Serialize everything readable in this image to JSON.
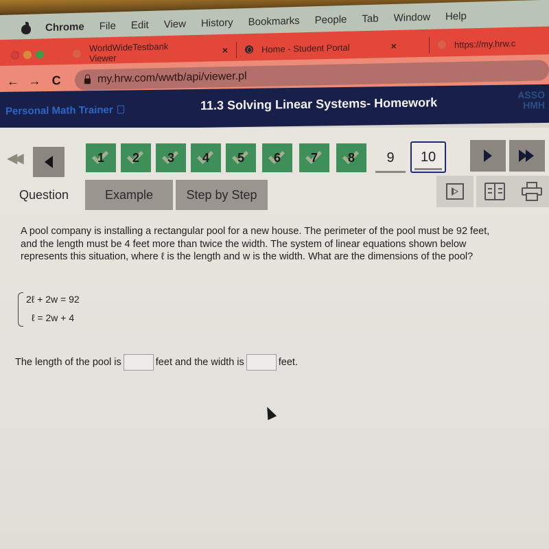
{
  "menubar": {
    "items": [
      "Chrome",
      "File",
      "Edit",
      "View",
      "History",
      "Bookmarks",
      "People",
      "Tab",
      "Window",
      "Help"
    ]
  },
  "browser": {
    "tabs": [
      {
        "title": "WorldWideTestbank Viewer",
        "favicon": "site-icon"
      },
      {
        "title": "Home - Student Portal",
        "favicon": "globe-icon"
      },
      {
        "title": "https://my.hrw.c",
        "favicon": "site-icon"
      }
    ],
    "url": "my.hrw.com/wwtb/api/viewer.pl",
    "nav": {
      "back": "←",
      "forward": "→",
      "reload": "C"
    },
    "close_glyph": "×"
  },
  "app": {
    "brand": "Personal Math Trainer",
    "title": "11.3 Solving Linear Systems- Homework",
    "logo_line1": "ASSO",
    "logo_line2": "HMH"
  },
  "question_nav": {
    "first": "first-icon",
    "prev": "prev-icon",
    "questions": [
      {
        "num": "1",
        "status": "completed"
      },
      {
        "num": "2",
        "status": "completed"
      },
      {
        "num": "3",
        "status": "completed"
      },
      {
        "num": "4",
        "status": "completed"
      },
      {
        "num": "5",
        "status": "completed"
      },
      {
        "num": "6",
        "status": "completed"
      },
      {
        "num": "7",
        "status": "completed"
      },
      {
        "num": "8",
        "status": "completed"
      },
      {
        "num": "9",
        "status": "unanswered"
      },
      {
        "num": "10",
        "status": "current"
      }
    ],
    "colors": {
      "completed": "#3e8f5a",
      "current_border": "#1b2b7a",
      "nav_button": "#8b8680"
    }
  },
  "tabs": {
    "question": "Question",
    "example": "Example",
    "step_by_step": "Step by Step"
  },
  "tools": [
    "video-icon",
    "book-icon",
    "print-icon"
  ],
  "question": {
    "text": "A pool company is installing a rectangular pool for a new house. The perimeter of the pool must be 92 feet, and the length must be 4 feet more than twice the width. The system of linear equations shown below represents this situation, where ℓ is the length and w is the width. What are the dimensions of the pool?",
    "equations": [
      "2ℓ + 2w = 92",
      "ℓ = 2w + 4"
    ],
    "answer_prefix": "The length of the pool is",
    "answer_middle": "feet and the width is",
    "answer_suffix": "feet.",
    "length_value": "",
    "width_value": ""
  }
}
